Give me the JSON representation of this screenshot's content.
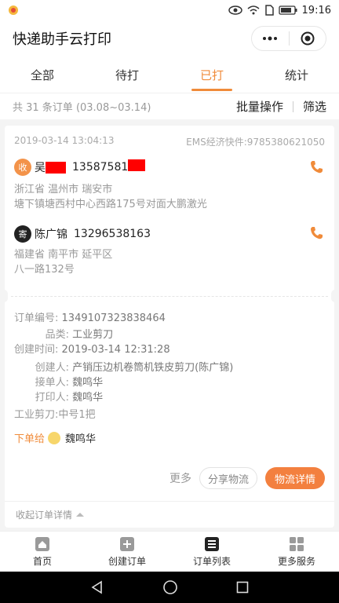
{
  "status_bar": {
    "time": "19:16"
  },
  "header": {
    "title": "快递助手云打印"
  },
  "tabs": [
    {
      "label": "全部",
      "active": false
    },
    {
      "label": "待打",
      "active": false
    },
    {
      "label": "已打",
      "active": true
    },
    {
      "label": "统计",
      "active": false
    }
  ],
  "summary": {
    "count_text": "共 31 条订单 (03.08~03.14)",
    "batch_label": "批量操作",
    "filter_label": "筛选"
  },
  "order": {
    "date": "2019-03-14 13:04:13",
    "carrier": "EMS经济快件:9785380621050",
    "receiver": {
      "badge": "收",
      "name": "吴",
      "phone": "13587581",
      "address_line1": "浙江省 温州市 瑞安市",
      "address_line2": "塘下镇塘西村中心西路175号对面大鹏激光"
    },
    "sender": {
      "badge": "寄",
      "name": "陈广锦",
      "phone": "13296538163",
      "address_line1": "福建省 南平市 延平区",
      "address_line2": "八一路132号"
    },
    "details": {
      "order_no_label": "订单编号:",
      "order_no": "1349107323838464",
      "category_label": "品类:",
      "category": "工业剪刀",
      "created_label": "创建时间:",
      "created": "2019-03-14 12:31:28",
      "creator_label": "创建人:",
      "creator": "产销压边机卷筒机铁皮剪刀(陈广锦)",
      "taker_label": "接单人:",
      "taker": "魏鸣华",
      "printer_label": "打印人:",
      "printer": "魏鸣华",
      "goods": "工业剪刀:中号1把"
    },
    "assign_label": "下单给",
    "assign_to": "魏鸣华",
    "more_label": "更多",
    "share_label": "分享物流",
    "logistics_label": "物流详情",
    "collapse_label": "收起订单详情"
  },
  "bottom_nav": [
    {
      "label": "首页",
      "icon": "home-icon"
    },
    {
      "label": "创建订单",
      "icon": "plus-square-icon"
    },
    {
      "label": "订单列表",
      "icon": "list-icon"
    },
    {
      "label": "更多服务",
      "icon": "grid-icon"
    }
  ],
  "colors": {
    "accent": "#f08b3a",
    "button_orange": "#f3803f",
    "redaction": "#ff0000"
  }
}
